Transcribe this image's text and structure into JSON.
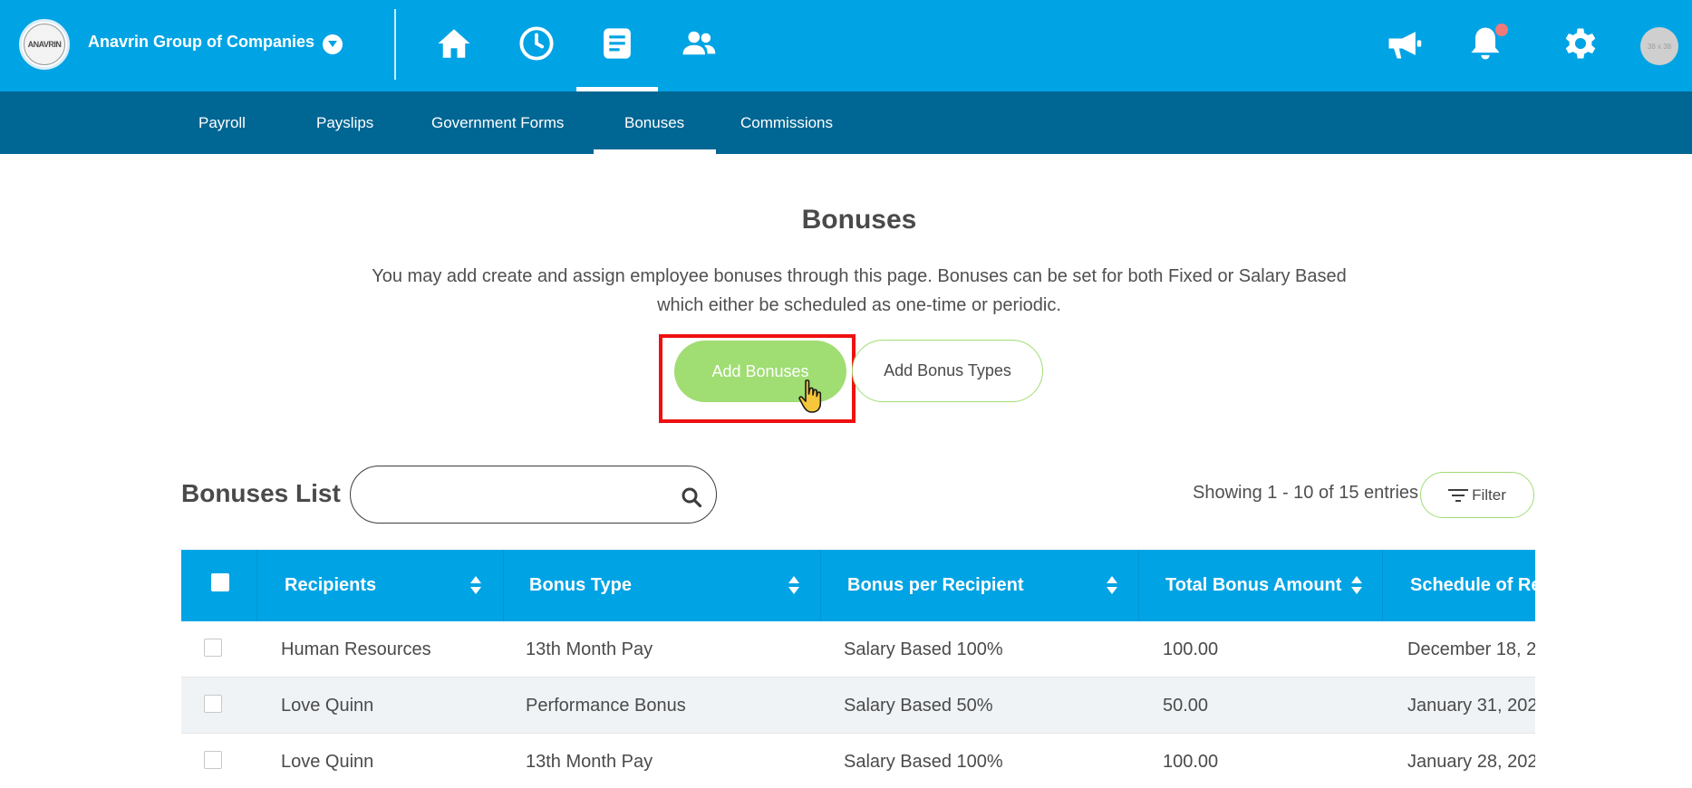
{
  "header": {
    "logo_text": "ANAVRIN",
    "company_name": "Anavrin Group of Companies",
    "nav_icons": [
      "home-icon",
      "clock-icon",
      "document-icon",
      "people-icon"
    ],
    "right_icons": [
      "megaphone-icon",
      "bell-icon",
      "gear-icon"
    ],
    "avatar_text": "38 x 38",
    "colors": {
      "bar": "#00a3e4",
      "subbar": "#006693"
    }
  },
  "subnav": {
    "tabs": [
      {
        "label": "Payroll"
      },
      {
        "label": "Payslips"
      },
      {
        "label": "Government Forms"
      },
      {
        "label": "Bonuses",
        "active": true
      },
      {
        "label": "Commissions"
      }
    ]
  },
  "page": {
    "title": "Bonuses",
    "description": "You may add create and assign employee bonuses through this page. Bonuses can be set for both Fixed or Salary Based which either be scheduled as one-time or periodic.",
    "add_bonuses_label": "Add Bonuses",
    "add_bonus_types_label": "Add Bonus Types",
    "accent_green": "#a0dd73",
    "highlight_color": "#ee1111"
  },
  "list": {
    "title": "Bonuses List",
    "search_placeholder": "",
    "entries_text": "Showing 1 - 10 of 15 entries",
    "filter_label": "Filter",
    "columns": [
      "Recipients",
      "Bonus Type",
      "Bonus per Recipient",
      "Total Bonus Amount",
      "Schedule of Re"
    ],
    "rows": [
      {
        "recipients": "Human Resources",
        "bonus_type": "13th Month Pay",
        "per_recipient": "Salary Based 100%",
        "total": "100.00",
        "schedule": "December 18, 20"
      },
      {
        "recipients": "Love Quinn",
        "bonus_type": "Performance Bonus",
        "per_recipient": "Salary Based 50%",
        "total": "50.00",
        "schedule": "January 31, 202"
      },
      {
        "recipients": "Love Quinn",
        "bonus_type": "13th Month Pay",
        "per_recipient": "Salary Based 100%",
        "total": "100.00",
        "schedule": "January 28, 202"
      }
    ]
  }
}
